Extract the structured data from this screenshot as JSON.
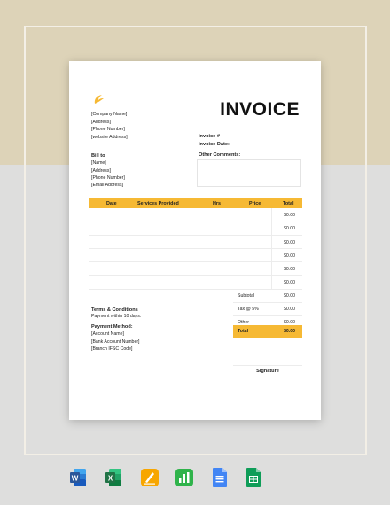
{
  "invoice": {
    "title": "INVOICE",
    "company": {
      "name": "[Company Name]",
      "address": "[Address]",
      "phone": "[Phone Number]",
      "website": "[website Address]"
    },
    "invoice_number_label": "Invoice #",
    "invoice_date_label": "Invoice Date:",
    "bill_to": {
      "heading": "Bill to",
      "name": "[Name]",
      "address": "[Address]",
      "phone": "[Phone Number]",
      "email": "[Email Address]"
    },
    "other_comments_label": "Other Comments:",
    "table": {
      "headers": [
        "Date",
        "Services Provided",
        "Hrs",
        "Price",
        "Total"
      ],
      "row_totals": [
        "$0.00",
        "$0.00",
        "$0.00",
        "$0.00",
        "$0.00",
        "$0.00"
      ]
    },
    "summary": {
      "subtotal_label": "Subtotal",
      "subtotal_value": "$0.00",
      "tax_label": "Tax @ 5%",
      "tax_value": "$0.00",
      "other_label": "Other",
      "other_value": "$0.00",
      "total_label": "Total",
      "total_value": "$0.00"
    },
    "terms": {
      "heading": "Terms & Conditions",
      "text": "Payment within 10 days."
    },
    "payment": {
      "heading": "Payment Method:",
      "account_name": "[Account Name]",
      "account_number": "[Bank Account Number]",
      "branch": "[Branch IFSC Code]"
    },
    "signature_label": "Signature"
  },
  "format_icons": [
    {
      "name": "word-icon",
      "color": "#2b579a"
    },
    {
      "name": "excel-icon",
      "color": "#217346"
    },
    {
      "name": "pages-icon",
      "color": "#f5a623"
    },
    {
      "name": "numbers-icon",
      "color": "#3aa53a"
    },
    {
      "name": "google-docs-icon",
      "color": "#4285f4"
    },
    {
      "name": "google-sheets-icon",
      "color": "#0f9d58"
    }
  ],
  "colors": {
    "accent": "#f6b934",
    "background_top": "#ddd3b8",
    "background_bottom": "#dededd"
  }
}
